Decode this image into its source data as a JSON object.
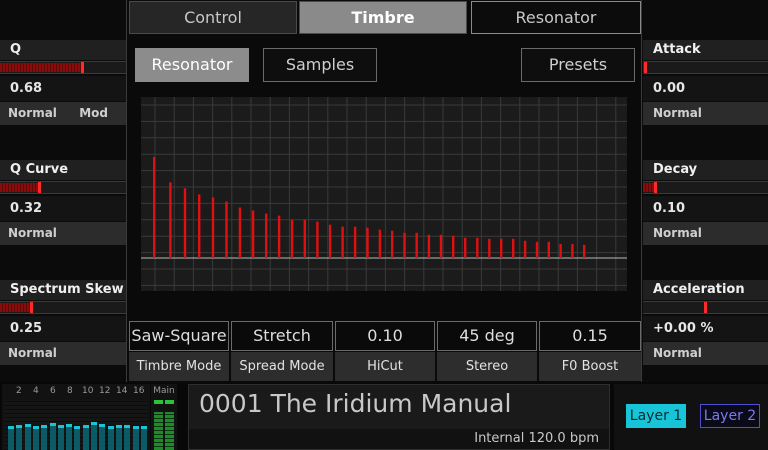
{
  "tabs": [
    {
      "label": "Control",
      "active": false
    },
    {
      "label": "Timbre",
      "active": true
    },
    {
      "label": "Resonator",
      "active": false
    }
  ],
  "subtabs": {
    "resonator": "Resonator",
    "samples": "Samples",
    "presets": "Presets"
  },
  "left_params": [
    {
      "name": "Q",
      "value": "0.68",
      "mode": "Normal",
      "mod": "Mod",
      "level": 0.66
    },
    {
      "name": "Q Curve",
      "value": "0.32",
      "mode": "Normal",
      "mod": "",
      "level": 0.32
    },
    {
      "name": "Spectrum Skew",
      "value": "0.25",
      "mode": "Normal",
      "mod": "",
      "level": 0.25
    }
  ],
  "right_params": [
    {
      "name": "Attack",
      "value": "0.00",
      "mode": "Normal",
      "level": 0.02
    },
    {
      "name": "Decay",
      "value": "0.10",
      "mode": "Normal",
      "level": 0.1
    },
    {
      "name": "Acceleration",
      "value": "+0.00 %",
      "mode": "Normal",
      "level": 0.5
    }
  ],
  "controls": [
    {
      "value": "Saw-Square",
      "label": "Timbre Mode"
    },
    {
      "value": "Stretch",
      "label": "Spread Mode"
    },
    {
      "value": "0.10",
      "label": "HiCut"
    },
    {
      "value": "45 deg",
      "label": "Stereo"
    },
    {
      "value": "0.15",
      "label": "F0 Boost"
    }
  ],
  "spectrum": {
    "harmonic_levels": [
      1.0,
      0.75,
      0.69,
      0.63,
      0.6,
      0.56,
      0.5,
      0.47,
      0.44,
      0.42,
      0.38,
      0.38,
      0.36,
      0.33,
      0.31,
      0.31,
      0.3,
      0.28,
      0.27,
      0.25,
      0.25,
      0.23,
      0.23,
      0.22,
      0.2,
      0.2,
      0.19,
      0.19,
      0.19,
      0.17,
      0.16,
      0.16,
      0.14,
      0.14,
      0.13
    ],
    "bar_color": "#e01010"
  },
  "meter": {
    "channel_labels": [
      "2",
      "4",
      "6",
      "8",
      "10",
      "12",
      "14",
      "16"
    ],
    "main_label": "Main",
    "levels": [
      0.48,
      0.5,
      0.52,
      0.47,
      0.5,
      0.54,
      0.5,
      0.52,
      0.48,
      0.5,
      0.55,
      0.52,
      0.47,
      0.5,
      0.5,
      0.47,
      0.48
    ],
    "accent": "#18c5d8"
  },
  "preset": {
    "name": "0001 The Iridium Manual",
    "tempo": "Internal 120.0 bpm"
  },
  "layers": {
    "layer1": "Layer 1",
    "layer2": "Layer 2"
  }
}
